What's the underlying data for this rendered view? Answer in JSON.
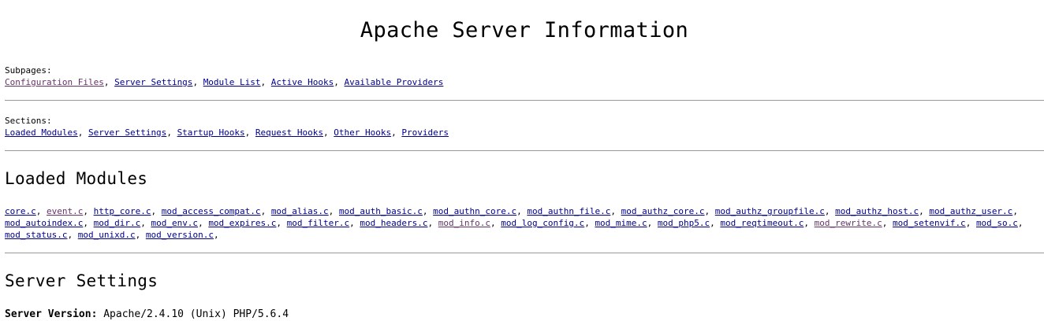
{
  "page": {
    "title": "Apache Server Information"
  },
  "subpages": {
    "label": "Subpages:",
    "links": [
      "Configuration Files",
      "Server Settings",
      "Module List",
      "Active Hooks",
      "Available Providers"
    ]
  },
  "sections": {
    "label": "Sections:",
    "links": [
      "Loaded Modules",
      "Server Settings",
      "Startup Hooks",
      "Request Hooks",
      "Other Hooks",
      "Providers"
    ]
  },
  "loaded_modules": {
    "heading": "Loaded Modules",
    "modules": [
      "core.c",
      "event.c",
      "http_core.c",
      "mod_access_compat.c",
      "mod_alias.c",
      "mod_auth_basic.c",
      "mod_authn_core.c",
      "mod_authn_file.c",
      "mod_authz_core.c",
      "mod_authz_groupfile.c",
      "mod_authz_host.c",
      "mod_authz_user.c",
      "mod_autoindex.c",
      "mod_dir.c",
      "mod_env.c",
      "mod_expires.c",
      "mod_filter.c",
      "mod_headers.c",
      "mod_info.c",
      "mod_log_config.c",
      "mod_mime.c",
      "mod_php5.c",
      "mod_reqtimeout.c",
      "mod_rewrite.c",
      "mod_setenvif.c",
      "mod_so.c",
      "mod_status.c",
      "mod_unixd.c",
      "mod_version.c"
    ]
  },
  "server_settings": {
    "heading": "Server Settings",
    "server_version_label": "Server Version:",
    "server_version_value": "Apache/2.4.10 (Unix) PHP/5.6.4"
  },
  "colors": {
    "link": "#00008b",
    "visited": "#663366",
    "rule": "#999999"
  }
}
